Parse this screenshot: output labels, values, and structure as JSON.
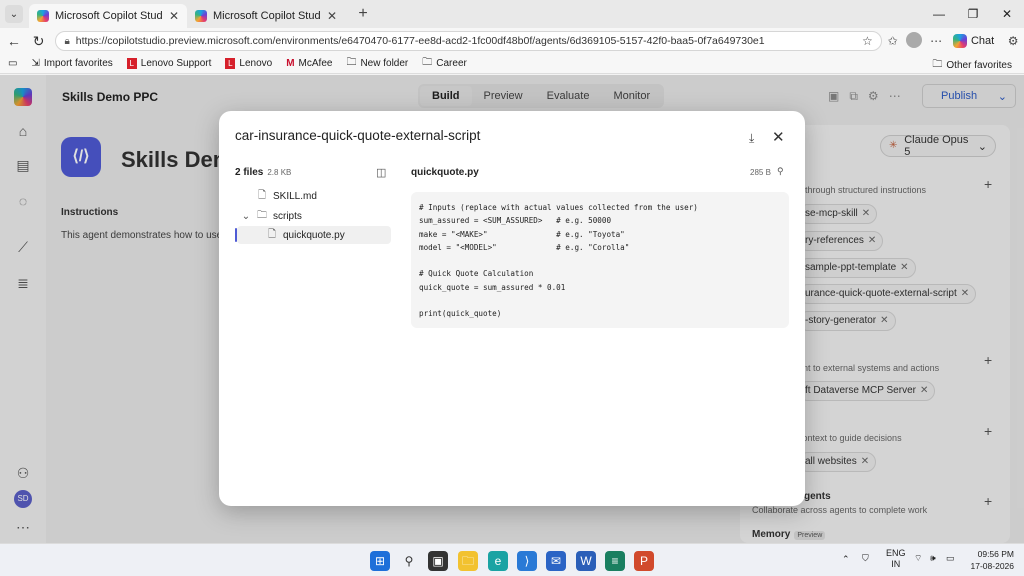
{
  "browser": {
    "tabs": [
      {
        "title": "Microsoft Copilot Studio",
        "active": true
      },
      {
        "title": "Microsoft Copilot Studio",
        "active": false
      }
    ],
    "url": "https://copilotstudio.preview.microsoft.com/environments/e6470470-6177-ee8d-acd2-1fc00df48b0f/agents/6d369105-5157-42f0-baa5-0f7a649730e1",
    "chat_label": "Chat",
    "favorites": [
      "Import favorites",
      "Lenovo Support",
      "Lenovo",
      "McAfee",
      "New folder",
      "Career"
    ],
    "other_favorites": "Other favorites"
  },
  "app": {
    "agent_name": "Skills Demo PPC",
    "modes": [
      "Build",
      "Preview",
      "Evaluate",
      "Monitor"
    ],
    "active_mode": "Build",
    "publish_label": "Publish",
    "agent_title": "Skills Demo",
    "instructions_label": "Instructions",
    "instructions_text": "This agent demonstrates how to use S",
    "avatar_initials": "SD"
  },
  "right_panel": {
    "model": "Claude Opus 5",
    "skills_desc": "s through structured instructions",
    "skills": [
      "se-mcp-skill",
      "ry-references",
      "sample-ppt-template",
      "urance-quick-quote-external-script",
      "-story-generator"
    ],
    "tools_desc": "ent to external systems and actions",
    "tools": [
      "ft Dataverse MCP Server"
    ],
    "knowledge_desc": "context to guide decisions",
    "knowledge": [
      "all websites"
    ],
    "agents_title": "gents",
    "agents_desc": "Collaborate across agents to complete work",
    "memory_title": "Memory",
    "memory_badge": "Preview"
  },
  "modal": {
    "title": "car-insurance-quick-quote-external-script",
    "files_count": "2 files",
    "files_size": "2.8 KB",
    "tree": [
      {
        "name": "SKILL.md",
        "type": "file"
      },
      {
        "name": "scripts",
        "type": "folder"
      },
      {
        "name": "quickquote.py",
        "type": "file"
      }
    ],
    "selected_file": "quickquote.py",
    "selected_size": "285 B",
    "code": "# Inputs (replace with actual values collected from the user)\nsum_assured = <SUM_ASSURED>   # e.g. 50000\nmake = \"<MAKE>\"               # e.g. \"Toyota\"\nmodel = \"<MODEL>\"             # e.g. \"Corolla\"\n\n# Quick Quote Calculation\nquick_quote = sum_assured * 0.01\n\nprint(quick_quote)"
  },
  "taskbar": {
    "lang": "ENG",
    "region": "IN",
    "time": "09:56 PM",
    "date": "17-08-2026"
  }
}
